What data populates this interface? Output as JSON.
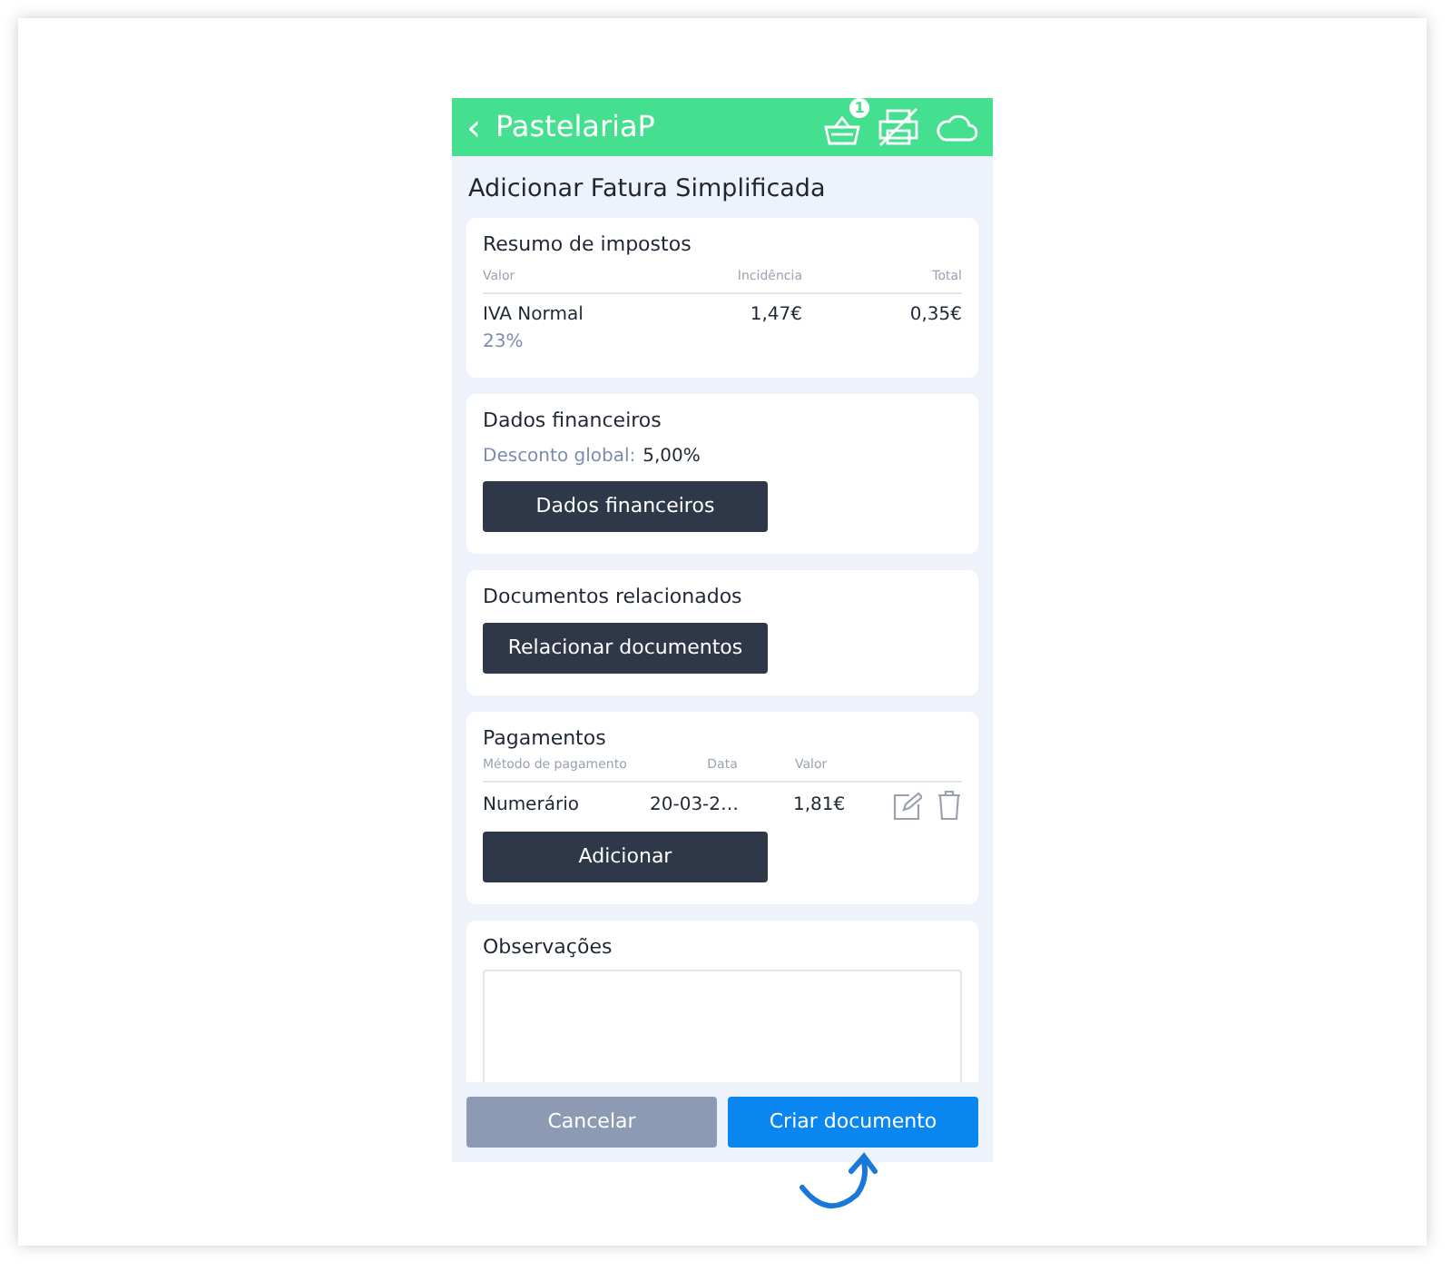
{
  "header": {
    "back": "‹",
    "title": "PastelariaP",
    "basket_badge": "1",
    "printer_disabled": true
  },
  "page_title": "Adicionar Fatura Simplificada",
  "taxes": {
    "title": "Resumo de impostos",
    "columns": [
      "Valor",
      "Incidência",
      "Total"
    ],
    "rows": [
      {
        "name": "IVA Normal",
        "rate": "23%",
        "base": "1,47€",
        "total": "0,35€"
      }
    ]
  },
  "financial": {
    "title": "Dados financeiros",
    "discount_label": "Desconto global:",
    "discount_value": "5,00%",
    "button": "Dados financeiros"
  },
  "related": {
    "title": "Documentos relacionados",
    "button": "Relacionar documentos"
  },
  "payments": {
    "title": "Pagamentos",
    "columns": [
      "Método de pagamento",
      "Data",
      "Valor"
    ],
    "rows": [
      {
        "method": "Numerário",
        "date": "20-03-2…",
        "value": "1,81€"
      }
    ],
    "button": "Adicionar"
  },
  "notes": {
    "title": "Observações"
  },
  "footer": [
    {
      "label": "Cancelar",
      "disabled": true,
      "kind": "secondary"
    },
    {
      "label": "Criar documento",
      "disabled": false,
      "kind": "primary"
    }
  ]
}
